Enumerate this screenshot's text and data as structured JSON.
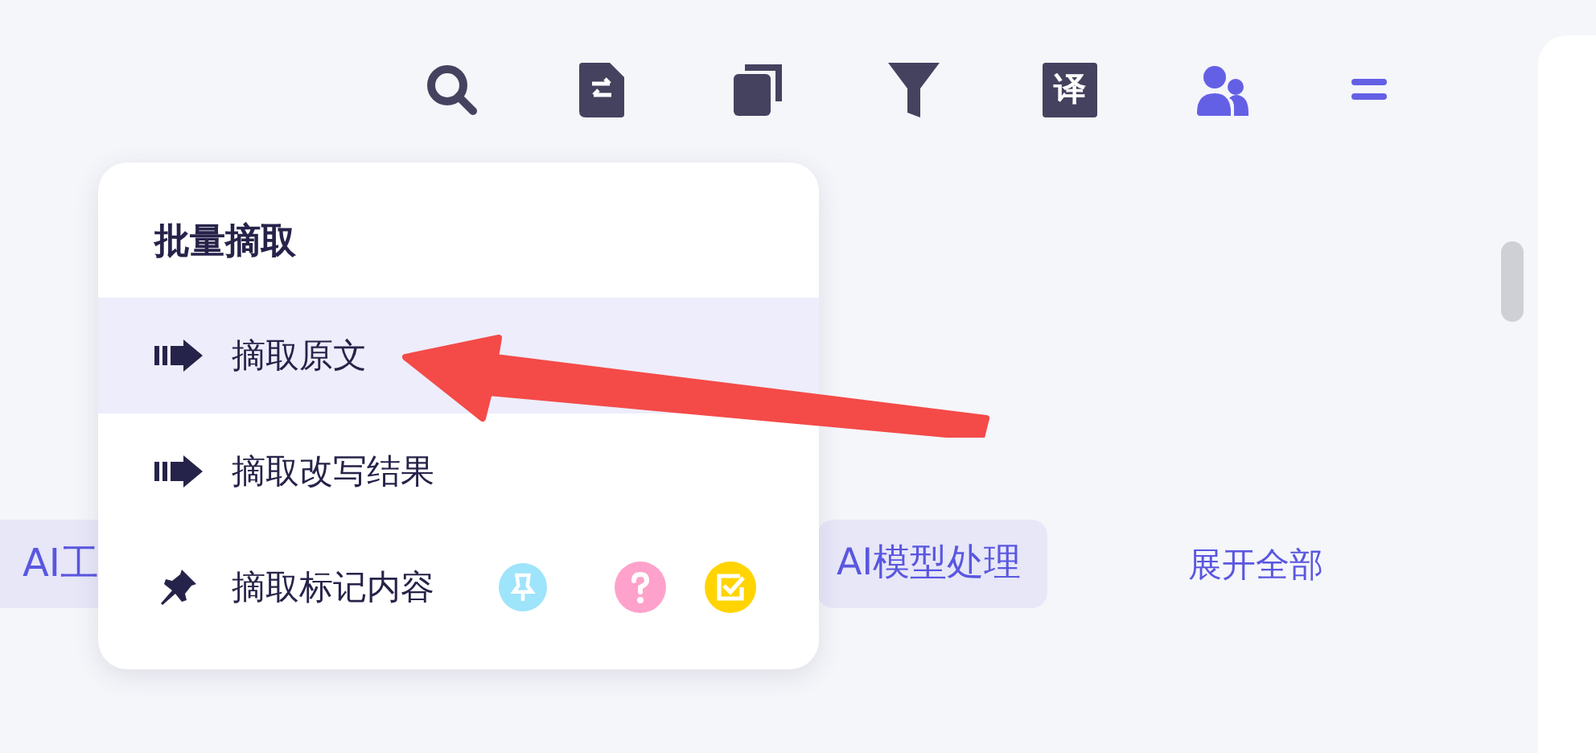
{
  "toolbar": [
    {
      "kind": "search"
    },
    {
      "kind": "doc-swap"
    },
    {
      "kind": "copy"
    },
    {
      "kind": "filter"
    },
    {
      "kind": "translate",
      "label": "译"
    },
    {
      "kind": "people",
      "selected": true
    },
    {
      "kind": "menu",
      "selected": true
    }
  ],
  "tags": [
    {
      "label": "AI工",
      "selected": true
    },
    {
      "label": "AI模型处理",
      "selected": true
    }
  ],
  "expand_link": "展开全部",
  "popover": {
    "title": "批量摘取",
    "items": [
      {
        "label": "摘取原文",
        "kind": "extract",
        "selected": true
      },
      {
        "label": "摘取改写结果",
        "kind": "extract",
        "selected": false
      },
      {
        "label": "摘取标记内容",
        "kind": "marked",
        "selected": false
      }
    ]
  }
}
